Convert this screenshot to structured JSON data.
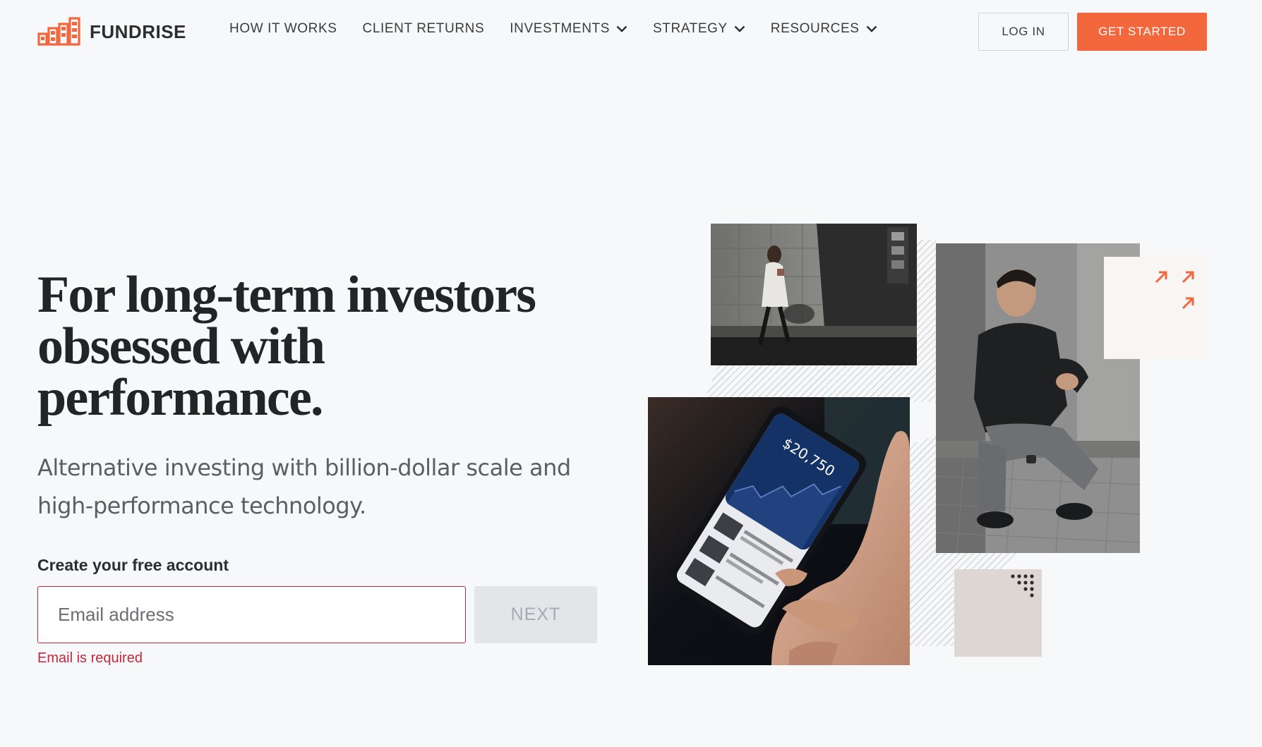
{
  "brand": {
    "name": "FUNDRISE",
    "accent_color": "#f2673c",
    "logo_icon": "building-bars-icon"
  },
  "nav": {
    "items": [
      {
        "label": "HOW IT WORKS",
        "dropdown": false
      },
      {
        "label": "CLIENT RETURNS",
        "dropdown": false
      },
      {
        "label": "INVESTMENTS",
        "dropdown": true
      },
      {
        "label": "STRATEGY",
        "dropdown": true
      },
      {
        "label": "RESOURCES",
        "dropdown": true
      }
    ],
    "login_label": "LOG IN",
    "get_started_label": "GET STARTED"
  },
  "hero": {
    "headline_lines": [
      "For long-term investors",
      "obsessed with",
      "performance."
    ],
    "subhead": "Alternative investing with billion-dollar scale and high-performance technology."
  },
  "signup": {
    "label": "Create your free account",
    "email_placeholder": "Email address",
    "email_value": "",
    "next_label": "NEXT",
    "error": "Email is required",
    "error_color": "#c5283d"
  },
  "collage": {
    "phone_screen_value": "$20,750"
  }
}
